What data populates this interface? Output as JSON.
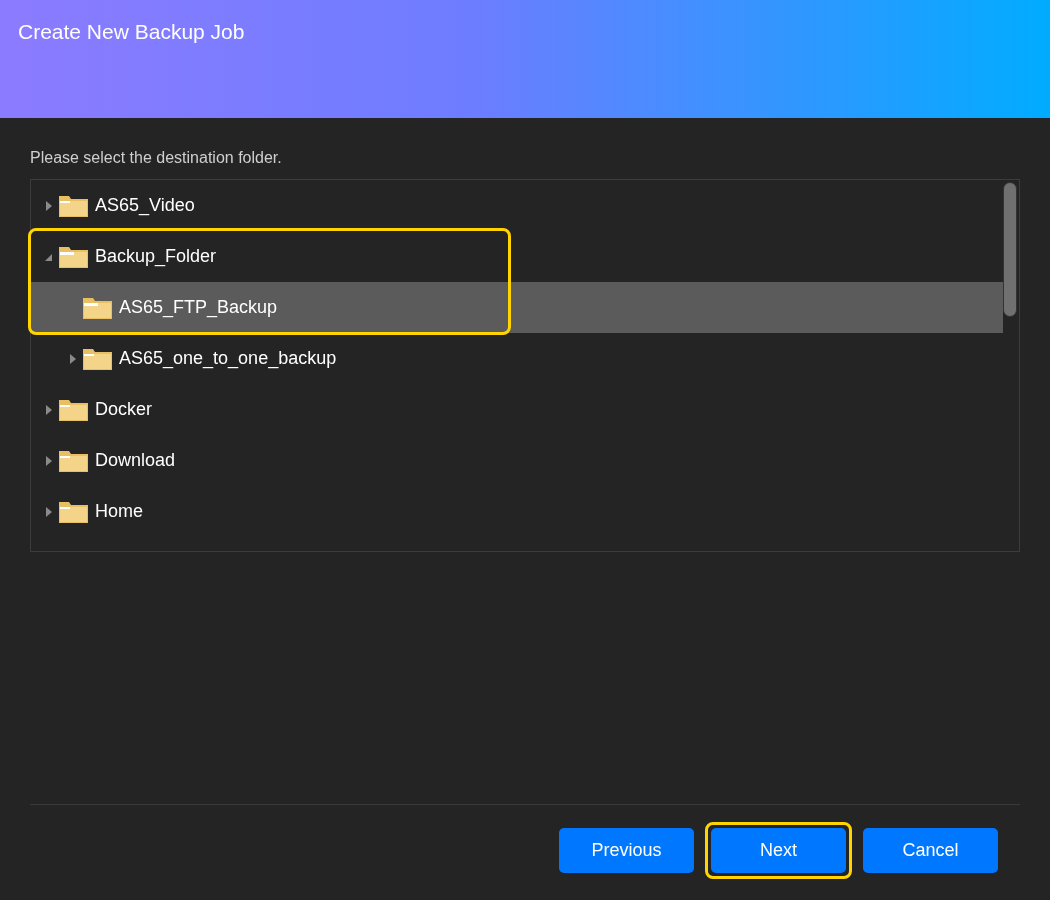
{
  "window": {
    "title": "Create New Backup Job"
  },
  "prompt": "Please select the destination folder.",
  "tree": [
    {
      "label": "AS65_Video",
      "expandable": true,
      "expanded": false,
      "selected": false,
      "highlighted": false
    },
    {
      "label": "Backup_Folder",
      "expandable": true,
      "expanded": true,
      "selected": false,
      "highlighted": true,
      "children": [
        {
          "label": "AS65_FTP_Backup",
          "expandable": false,
          "expanded": false,
          "selected": true,
          "highlighted": true
        },
        {
          "label": "AS65_one_to_one_backup",
          "expandable": true,
          "expanded": false,
          "selected": false,
          "highlighted": false
        }
      ]
    },
    {
      "label": "Docker",
      "expandable": true,
      "expanded": false,
      "selected": false,
      "highlighted": false
    },
    {
      "label": "Download",
      "expandable": true,
      "expanded": false,
      "selected": false,
      "highlighted": false
    },
    {
      "label": "Home",
      "expandable": true,
      "expanded": false,
      "selected": false,
      "highlighted": false
    }
  ],
  "buttons": [
    {
      "label": "Previous",
      "highlighted": false
    },
    {
      "label": "Next",
      "highlighted": true
    },
    {
      "label": "Cancel",
      "highlighted": false
    }
  ]
}
